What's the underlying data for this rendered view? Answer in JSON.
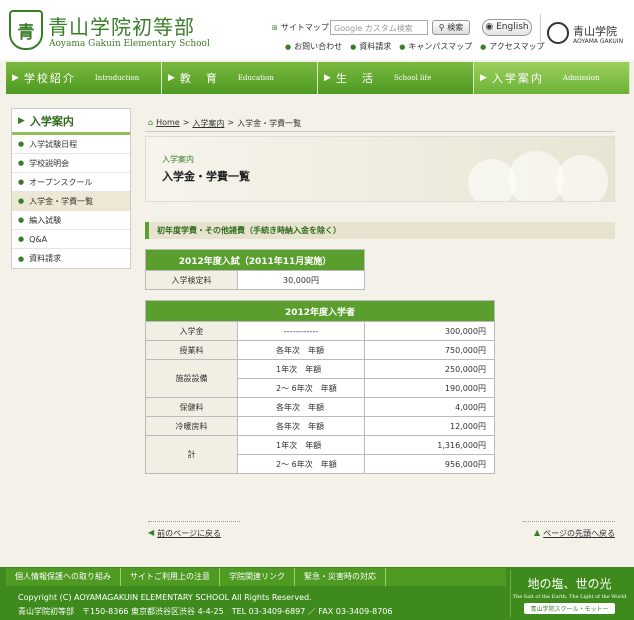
{
  "header": {
    "logo_mark": "青",
    "school_name": "青山学院初等部",
    "school_name_en": "Aoyama Gakuin Elementary School",
    "sitemap_label": "サイトマップ",
    "search_placeholder": "Google カスタム検索",
    "search_button": "検索",
    "english_button": "English",
    "utility_links": [
      "お問い合わせ",
      "資料請求",
      "キャンパスマップ",
      "アクセスマップ"
    ],
    "org_name": "青山学院",
    "org_name_en": "AOYAMA GAKUIN"
  },
  "nav": [
    {
      "jp": "学校紹介",
      "en": "Introduction"
    },
    {
      "jp": "教　育",
      "en": "Education"
    },
    {
      "jp": "生　活",
      "en": "School life"
    },
    {
      "jp": "入学案内",
      "en": "Admission"
    }
  ],
  "sidebar": {
    "title": "入学案内",
    "items": [
      {
        "label": "入学試験日程"
      },
      {
        "label": "学校説明会"
      },
      {
        "label": "オープンスクール"
      },
      {
        "label": "入学金・学費一覧"
      },
      {
        "label": "編入試験"
      },
      {
        "label": "Q&A"
      },
      {
        "label": "資料請求"
      }
    ]
  },
  "breadcrumb": {
    "home": "Home",
    "sep": ">",
    "level1": "入学案内",
    "current": "入学金・学費一覧"
  },
  "page": {
    "category": "入学案内",
    "title": "入学金・学費一覧",
    "section_heading": "初年度学費・その他諸費（手続き時納入金を除く）"
  },
  "exam_table": {
    "header": "2012年度入試（2011年11月実施）",
    "row_label": "入学検定料",
    "row_value": "30,000円"
  },
  "fee_table": {
    "header": "2012年度入学者",
    "rows": [
      {
        "label": "入学金",
        "sub": "------------",
        "amount": "300,000円"
      },
      {
        "label": "授業料",
        "sub": "各年次　年額",
        "amount": "750,000円"
      },
      {
        "label": "施設設備",
        "sub": "1年次　年額",
        "amount": "250,000円"
      },
      {
        "label": "",
        "sub": "2～ 6年次　年額",
        "amount": "190,000円"
      },
      {
        "label": "保健料",
        "sub": "各年次　年額",
        "amount": "4,000円"
      },
      {
        "label": "冷暖房料",
        "sub": "各年次　年額",
        "amount": "12,000円"
      },
      {
        "label": "計",
        "sub": "1年次　年額",
        "amount": "1,316,000円"
      },
      {
        "label": "",
        "sub": "2～ 6年次　年額",
        "amount": "956,000円"
      }
    ]
  },
  "page_links": {
    "back": "前のページに戻る",
    "top": "ページの先頭へ戻る"
  },
  "footer": {
    "links": [
      "個人情報保護への取り組み",
      "サイトご利用上の注意",
      "学院関連リンク",
      "緊急・災害時の対応"
    ],
    "copyright": "Copyright (C) AOYAMAGAKUIN ELEMENTARY SCHOOL All Rights Reserved.",
    "address": "青山学院初等部　〒150-8366 東京都渋谷区渋谷 4-4-25　TEL 03-3409-6897 ／ FAX 03-3409-8706",
    "motto": "地の塩、世の光",
    "motto_en": "The Salt of the Earth, The Light of the World",
    "motto_button": "青山学院スクール・モットー"
  },
  "colors": {
    "brand_green": "#3a7d29",
    "nav_green": "#5aa02c",
    "background": "#f3f1e8"
  }
}
